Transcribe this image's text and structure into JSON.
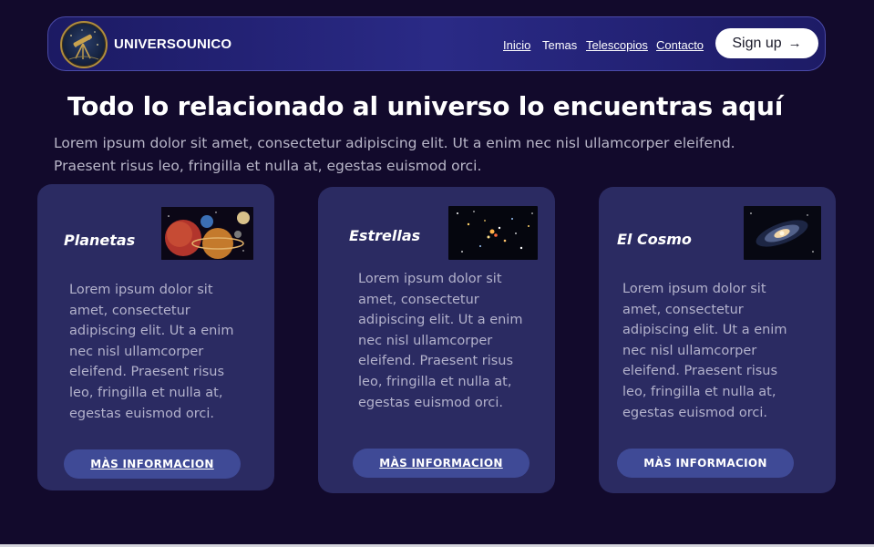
{
  "nav": {
    "brand": "UNIVERSOUNICO",
    "links": [
      "Inicio",
      "Temas",
      "Telescopios",
      "Contacto"
    ],
    "signup_label": "Sign up",
    "signup_arrow": "→"
  },
  "hero": {
    "title": "Todo lo relacionado al universo lo encuentras aquí",
    "text": "Lorem ipsum dolor sit amet, consectetur adipiscing elit. Ut a enim nec nisl ullamcorper eleifend. Praesent risus leo, fringilla et nulla at, egestas euismod orci."
  },
  "cards": [
    {
      "title": "Planetas",
      "text": "Lorem ipsum dolor sit amet, consectetur adipiscing elit. Ut a enim nec nisl ullamcorper eleifend. Praesent risus leo, fringilla et nulla at, egestas euismod orci.",
      "button": "MÀS INFORMACION"
    },
    {
      "title": "Estrellas",
      "text": "Lorem ipsum dolor sit amet, consectetur adipiscing elit. Ut a enim nec nisl ullamcorper eleifend. Praesent risus leo, fringilla et nulla at, egestas euismod orci.",
      "button": "MÀS INFORMACION"
    },
    {
      "title": "El Cosmo",
      "text": "Lorem ipsum dolor sit amet, consectetur adipiscing elit. Ut a enim nec nisl ullamcorper eleifend. Praesent risus leo, fringilla et nulla at, egestas euismod orci.",
      "button": "MÀS INFORMACION"
    }
  ],
  "colors": {
    "background": "#120a2c",
    "navbar": "#25237a",
    "card": "#2b2b62",
    "button": "#3f4a96"
  },
  "icons": [
    "telescope-logo-icon",
    "arrow-right-icon"
  ]
}
